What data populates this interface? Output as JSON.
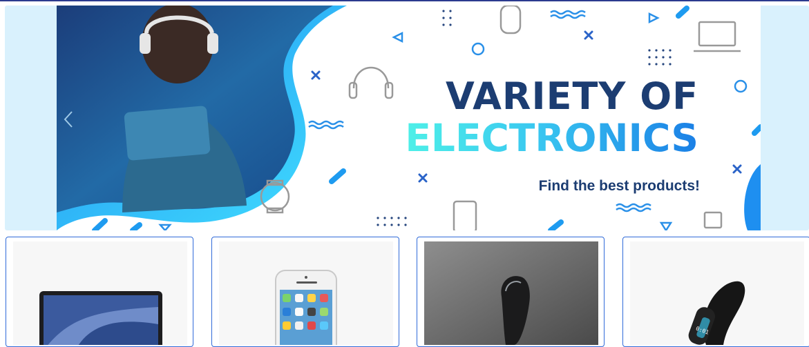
{
  "banner": {
    "title_line1": "VARIETY OF",
    "title_line2": "ELECTRONICS",
    "tagline": "Find the best products!"
  },
  "colors": {
    "accent_dark": "#1c3d72",
    "accent_cyan": "#39c7f0",
    "carousel_bg": "#d9f1fd",
    "card_border": "#2f6ad9"
  },
  "icons": {
    "prev": "chevron-left-icon"
  },
  "products": [
    {
      "name": "laptop"
    },
    {
      "name": "smartphone"
    },
    {
      "name": "smart-speaker"
    },
    {
      "name": "fitness-band"
    }
  ]
}
